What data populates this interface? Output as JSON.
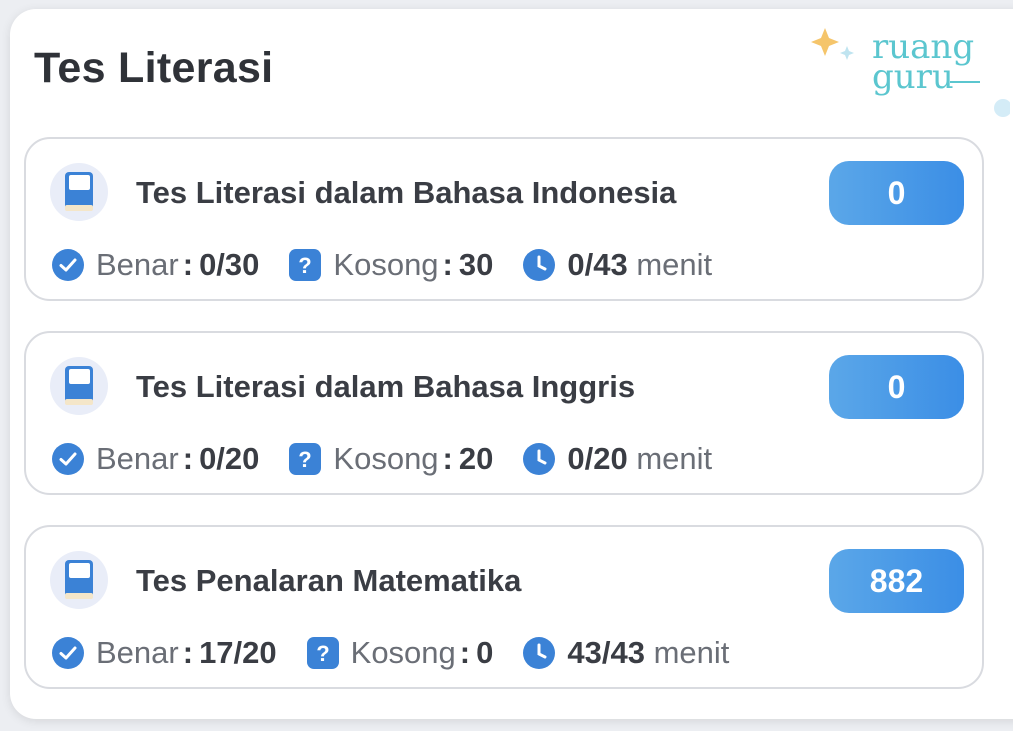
{
  "header": {
    "title": "Tes Literasi"
  },
  "logo": {
    "line1": "ruang",
    "line2": "guru"
  },
  "colors": {
    "accent": "#3b8ee6",
    "icon_blue": "#3b82d6",
    "logo_teal": "#5bc6cf",
    "spark_yellow": "#f5c56b"
  },
  "labels": {
    "benar": "Benar",
    "kosong": "Kosong",
    "menit": "menit"
  },
  "cards": [
    {
      "title": "Tes Literasi dalam Bahasa Indonesia",
      "score": "0",
      "benar": "0/30",
      "kosong": "30",
      "waktu": "0/43"
    },
    {
      "title": "Tes Literasi dalam Bahasa Inggris",
      "score": "0",
      "benar": "0/20",
      "kosong": "20",
      "waktu": "0/20"
    },
    {
      "title": "Tes Penalaran Matematika",
      "score": "882",
      "benar": "17/20",
      "kosong": "0",
      "waktu": "43/43"
    }
  ]
}
